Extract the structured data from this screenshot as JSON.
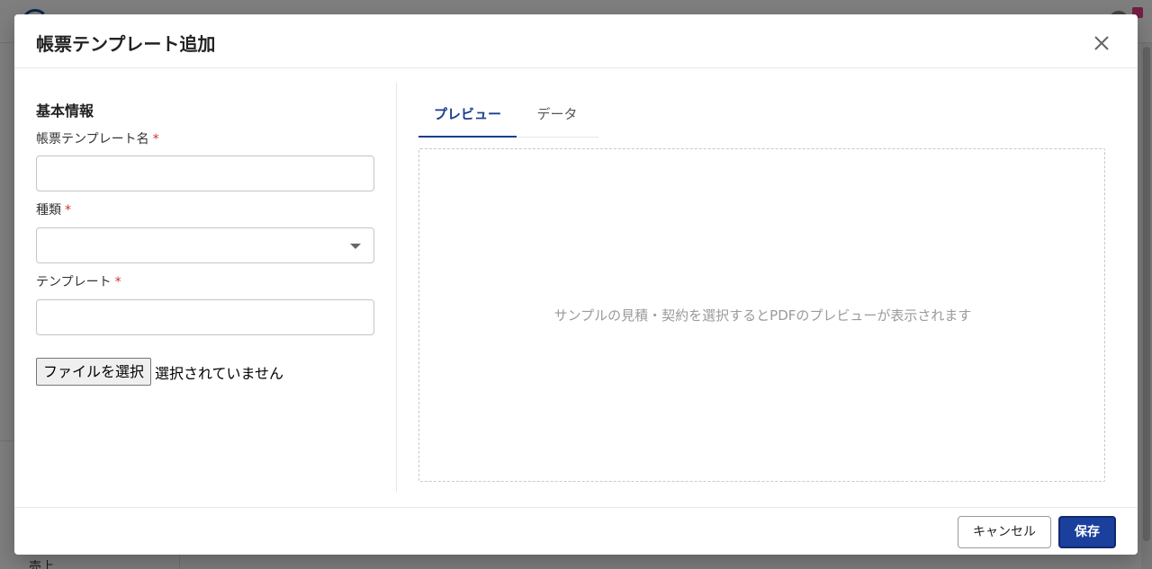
{
  "background": {
    "sidebar_item": "売上"
  },
  "modal": {
    "title": "帳票テンプレート追加",
    "close_icon": "close-icon"
  },
  "form": {
    "section_title": "基本情報",
    "name_label": "帳票テンプレート名",
    "name_value": "",
    "type_label": "種類",
    "type_value": "",
    "template_label": "テンプレート",
    "template_value": "",
    "required_mark": "*",
    "file_button_label": "ファイルを選択",
    "file_status": "選択されていません"
  },
  "tabs": [
    {
      "label": "プレビュー",
      "active": true
    },
    {
      "label": "データ",
      "active": false
    }
  ],
  "preview": {
    "message": "サンプルの見積・契約を選択するとPDFのプレビューが表示されます"
  },
  "footer": {
    "cancel_label": "キャンセル",
    "save_label": "保存"
  },
  "colors": {
    "accent": "#1a3f9c",
    "required": "#d32f2f"
  }
}
